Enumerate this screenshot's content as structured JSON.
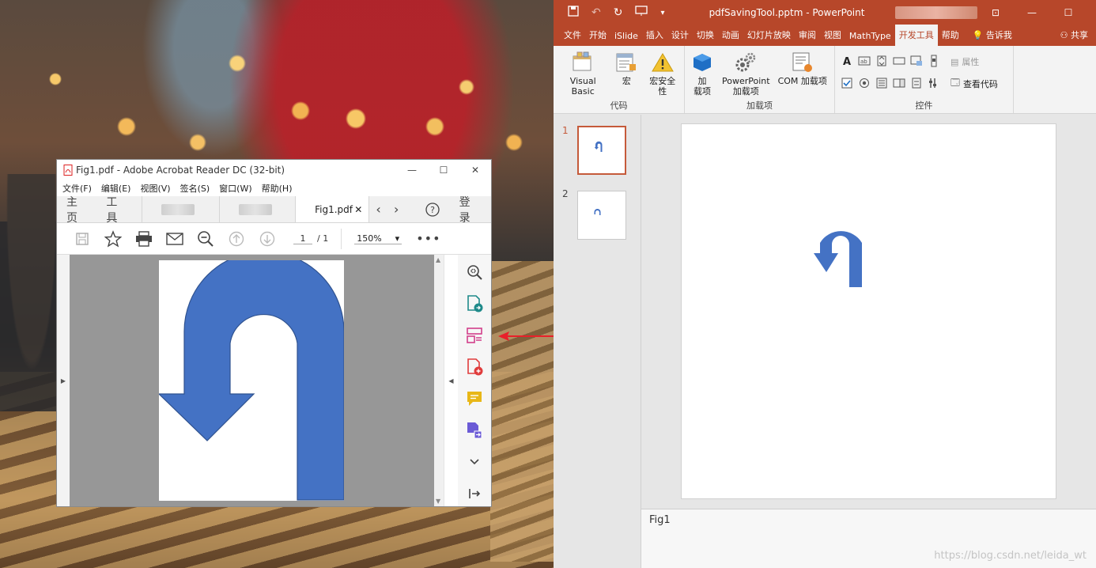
{
  "acrobat": {
    "title": "Fig1.pdf - Adobe Acrobat Reader DC (32-bit)",
    "menu": [
      "文件(F)",
      "编辑(E)",
      "视图(V)",
      "签名(S)",
      "窗口(W)",
      "帮助(H)"
    ],
    "tabs": {
      "home": "主页",
      "tools": "工具",
      "file_tab": "Fig1.pdf",
      "login": "登录"
    },
    "page_current": "1",
    "page_total": "/ 1",
    "zoom": "150%",
    "icons": [
      "save-icon",
      "star-icon",
      "print-icon",
      "mail-icon",
      "zoom-out-icon",
      "page-up-icon",
      "page-down-icon",
      "more-icon"
    ],
    "right_panel": [
      "zoom-tool-icon",
      "export-pdf-icon",
      "organize-pages-icon",
      "create-pdf-icon",
      "comment-icon",
      "export-pdf2-icon",
      "expand-icon",
      "collapse-panel-icon"
    ],
    "colors": {
      "shape_fill": "#4472c4",
      "shape_stroke": "#2f528f",
      "accent_arrow": "#e8212a"
    }
  },
  "ppt": {
    "doc_title": "pdfSavingTool.pptm  -  PowerPoint",
    "tabs": [
      "文件",
      "开始",
      "iSlide",
      "插入",
      "设计",
      "切换",
      "动画",
      "幻灯片放映",
      "审阅",
      "视图",
      "MathType",
      "开发工具",
      "帮助"
    ],
    "active_tab": "开发工具",
    "tell_me": "告诉我",
    "share": "共享",
    "ribbon": {
      "code": {
        "name": "代码",
        "visual_basic": "Visual Basic",
        "macro": "宏",
        "macro_security": "宏安全性"
      },
      "addins": {
        "name": "加载项",
        "addin1": "加",
        "addin2": "载项",
        "ppt_addin1": "PowerPoint",
        "ppt_addin2": "加载项",
        "com_addin": "COM 加载项"
      },
      "controls": {
        "name": "控件",
        "properties": "属性",
        "view_code": "查看代码"
      }
    },
    "slides": [
      {
        "number": "1"
      },
      {
        "number": "2"
      }
    ],
    "notes": "Fig1",
    "colors": {
      "brand": "#b7472a",
      "shape": "#4472c4"
    }
  },
  "watermark": "https://blog.csdn.net/leida_wt"
}
